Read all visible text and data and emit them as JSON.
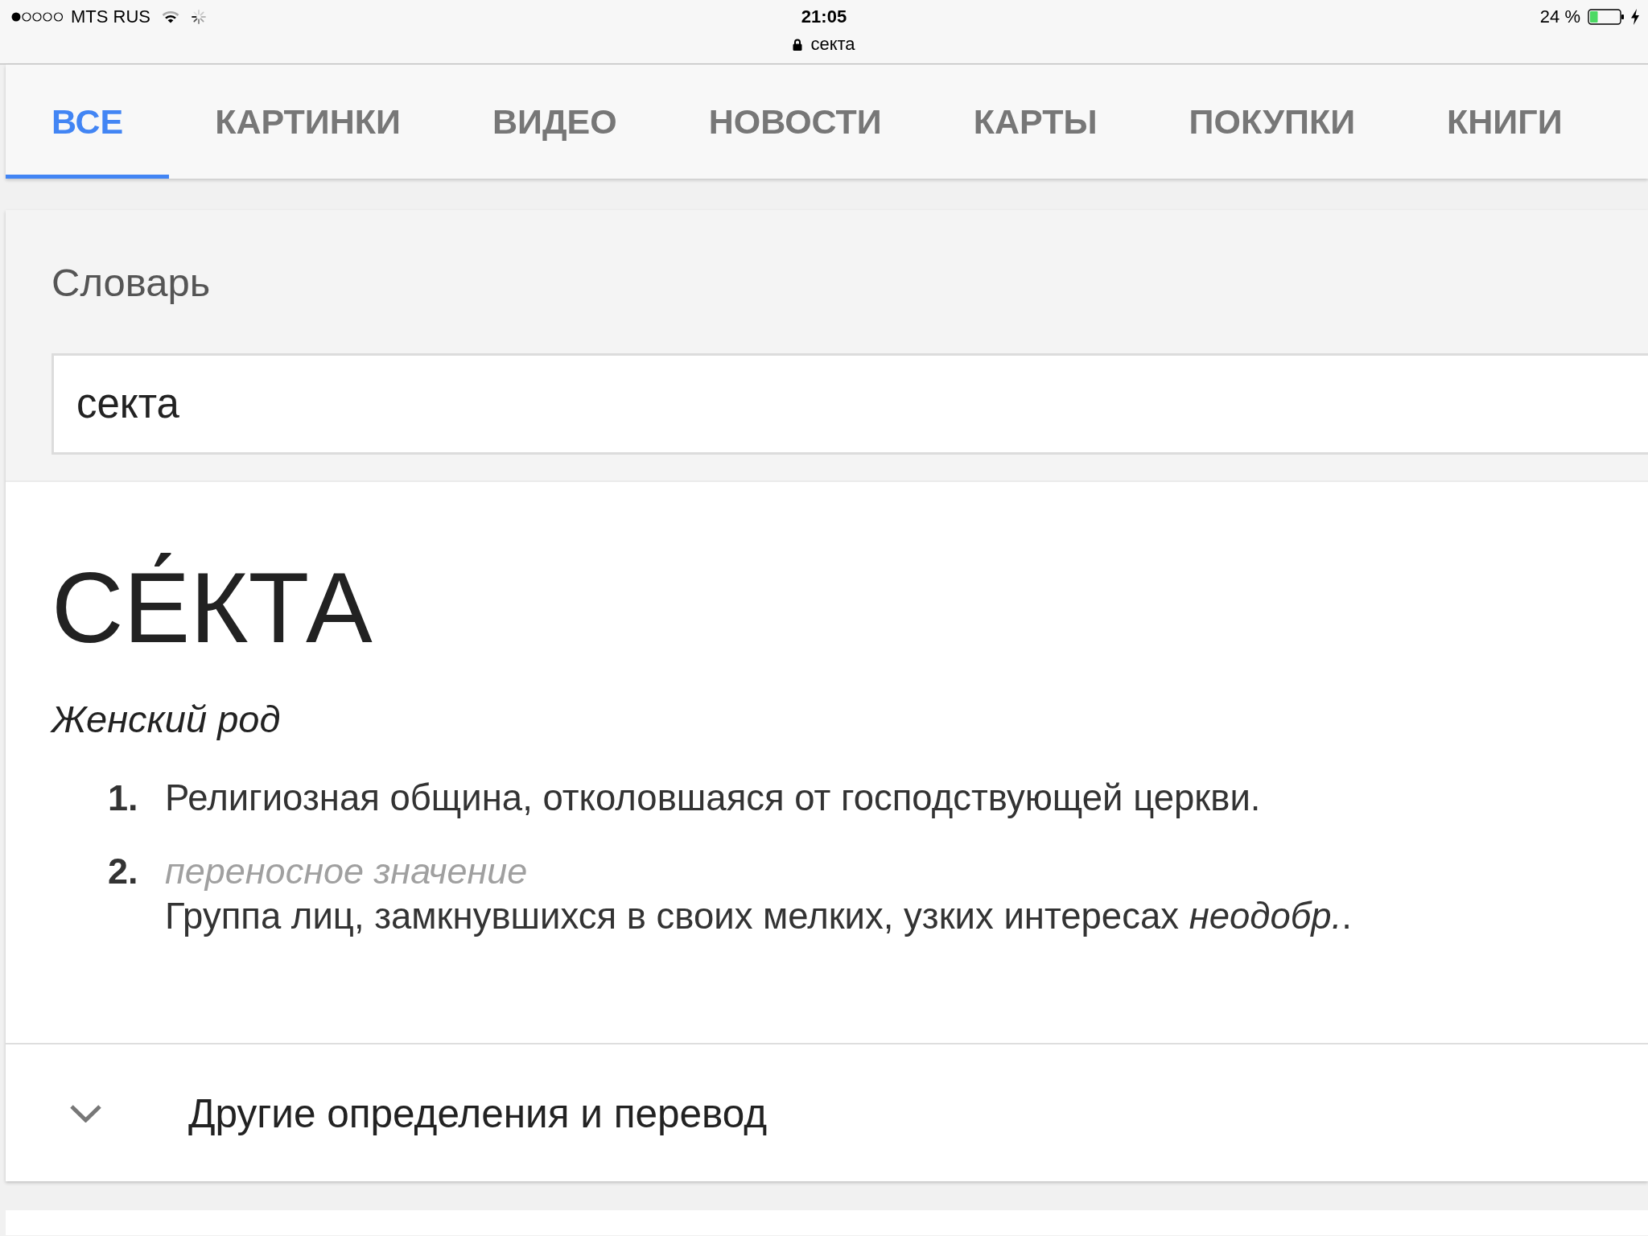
{
  "status_bar": {
    "carrier": "MTS RUS",
    "time": "21:05",
    "url": "секта",
    "battery": "24 %"
  },
  "tabs": [
    {
      "label": "ВСЕ",
      "selected": true
    },
    {
      "label": "КАРТИНКИ",
      "selected": false
    },
    {
      "label": "ВИДЕО",
      "selected": false
    },
    {
      "label": "НОВОСТИ",
      "selected": false
    },
    {
      "label": "КАРТЫ",
      "selected": false
    },
    {
      "label": "ПОКУПКИ",
      "selected": false
    },
    {
      "label": "КНИГИ",
      "selected": false
    }
  ],
  "dictionary": {
    "title": "Словарь",
    "search": {
      "value": "секта"
    },
    "headword": "СЕ́КТА",
    "gender": "Женский род",
    "definitions": [
      {
        "number": "1.",
        "text": "Религиозная община, отколовшаяся от господствующей церкви."
      },
      {
        "number": "2.",
        "label": "переносное значение",
        "text": "Группа лиц, замкнувшихся в своих мелких, узких интересах *неодобр.*."
      }
    ],
    "more": {
      "label": "Другие определения и перевод",
      "expanded": false
    }
  }
}
